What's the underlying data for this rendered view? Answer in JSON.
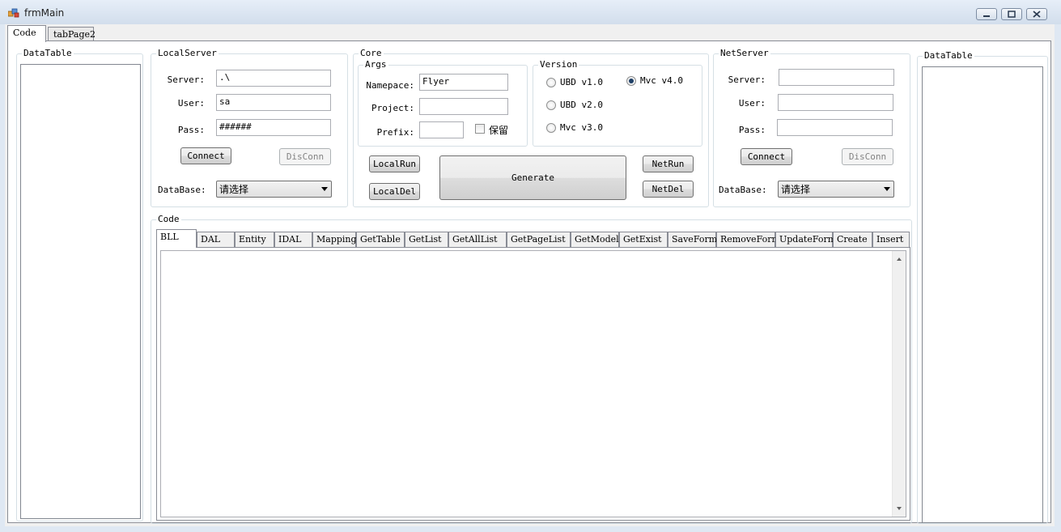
{
  "window": {
    "title": "frmMain"
  },
  "top_tabs": [
    {
      "label": "Code"
    },
    {
      "label": "tabPage2"
    }
  ],
  "left_datatable": {
    "title": "DataTable"
  },
  "right_datatable": {
    "title": "DataTable"
  },
  "local_server": {
    "title": "LocalServer",
    "server_label": "Server:",
    "server_value": ".\\",
    "user_label": "User:",
    "user_value": "sa",
    "pass_label": "Pass:",
    "pass_value": "######",
    "connect_label": "Connect",
    "disconn_label": "DisConn",
    "database_label": "DataBase:",
    "database_value": "请选择"
  },
  "core": {
    "title": "Core",
    "args": {
      "title": "Args",
      "namespace_label": "Namepace:",
      "namespace_value": "Flyer",
      "project_label": "Project:",
      "project_value": "",
      "prefix_label": "Prefix:",
      "prefix_value": "",
      "keep_label": "保留"
    },
    "version": {
      "title": "Version",
      "options": [
        {
          "label": "UBD v1.0",
          "selected": false
        },
        {
          "label": "UBD v2.0",
          "selected": false
        },
        {
          "label": "Mvc v3.0",
          "selected": false
        },
        {
          "label": "Mvc v4.0",
          "selected": true
        }
      ]
    },
    "localrun_label": "LocalRun",
    "localdel_label": "LocalDel",
    "generate_label": "Generate",
    "netrun_label": "NetRun",
    "netdel_label": "NetDel"
  },
  "net_server": {
    "title": "NetServer",
    "server_label": "Server:",
    "server_value": "",
    "user_label": "User:",
    "user_value": "",
    "pass_label": "Pass:",
    "pass_value": "",
    "connect_label": "Connect",
    "disconn_label": "DisConn",
    "database_label": "DataBase:",
    "database_value": "请选择"
  },
  "code_group": {
    "title": "Code",
    "tabs": [
      "BLL",
      "DAL",
      "Entity",
      "IDAL",
      "Mapping",
      "GetTable",
      "GetList",
      "GetAllList",
      "GetPageList",
      "GetModel",
      "GetExist",
      "SaveForm",
      "RemoveForm",
      "UpdateForm",
      "Create",
      "Insert"
    ]
  }
}
